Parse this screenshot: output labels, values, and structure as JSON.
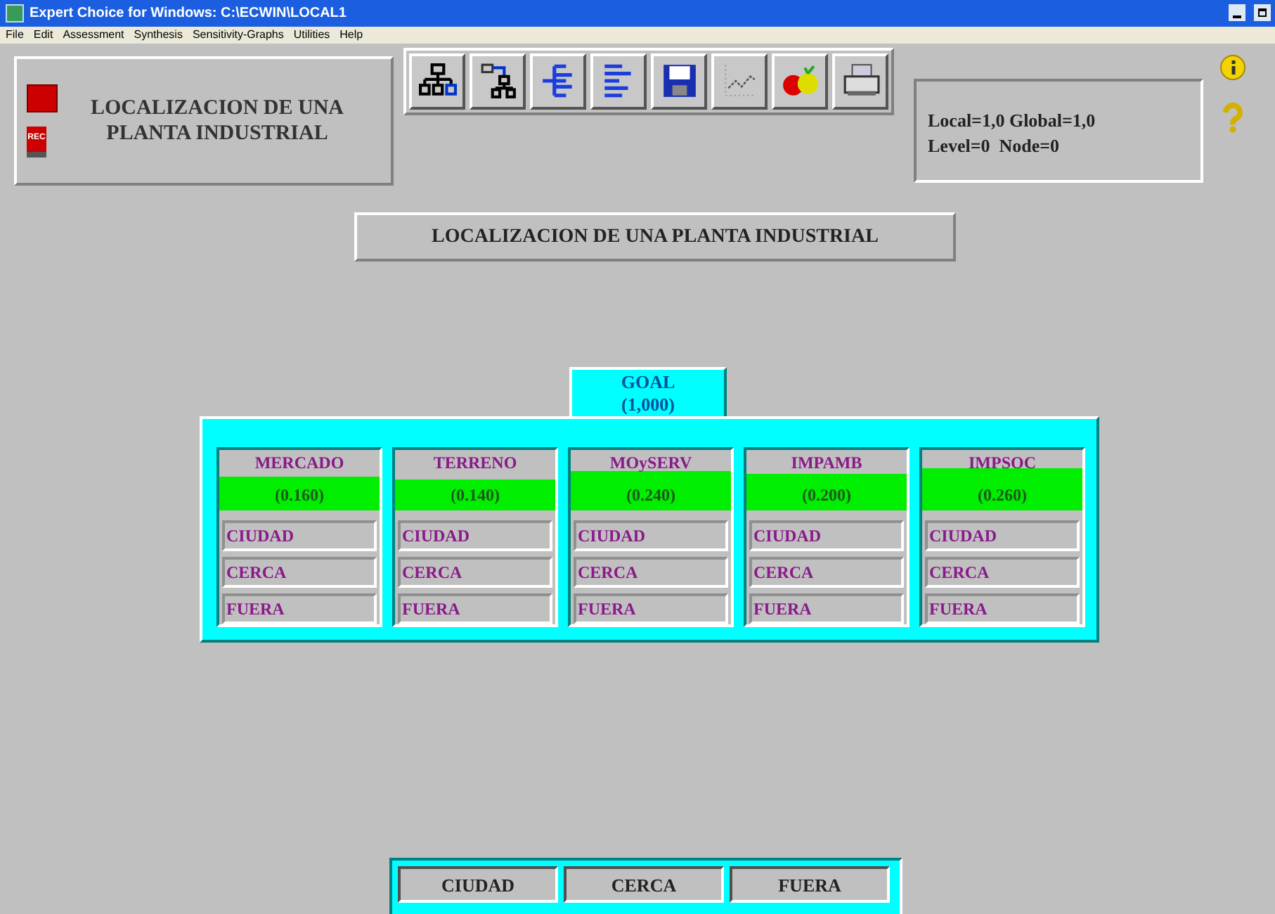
{
  "window": {
    "title": "Expert Choice for Windows: C:\\ECWIN\\LOCAL1"
  },
  "menu": [
    "File",
    "Edit",
    "Assessment",
    "Synthesis",
    "Sensitivity-Graphs",
    "Utilities",
    "Help"
  ],
  "model_panel": {
    "record_label": "REC",
    "title": "LOCALIZACION DE UNA PLANTA INDUSTRIAL"
  },
  "toolbar": [
    {
      "kind": "hierarchy"
    },
    {
      "kind": "transfer"
    },
    {
      "kind": "tree"
    },
    {
      "kind": "list"
    },
    {
      "kind": "save"
    },
    {
      "kind": "graph"
    },
    {
      "kind": "fruit"
    },
    {
      "kind": "print"
    }
  ],
  "info_panel": {
    "line_1": "Local=1,0 Global=1,0",
    "line_2": "Level=0  Node=0"
  },
  "heading": "LOCALIZACION DE UNA PLANTA INDUSTRIAL",
  "goal": {
    "label": "GOAL",
    "priority": "(1,000)"
  },
  "criteria": [
    {
      "name": "MERCADO",
      "priority": "(0.160)",
      "alternatives": [
        "CIUDAD",
        "CERCA",
        "FUERA"
      ]
    },
    {
      "name": "TERRENO",
      "priority": "(0.140)",
      "alternatives": [
        "CIUDAD",
        "CERCA",
        "FUERA"
      ]
    },
    {
      "name": "MOySERV",
      "priority": "(0.240)",
      "alternatives": [
        "CIUDAD",
        "CERCA",
        "FUERA"
      ]
    },
    {
      "name": "IMPAMB",
      "priority": "(0.200)",
      "alternatives": [
        "CIUDAD",
        "CERCA",
        "FUERA"
      ]
    },
    {
      "name": "IMPSOC",
      "priority": "(0.260)",
      "alternatives": [
        "CIUDAD",
        "CERCA",
        "FUERA"
      ]
    }
  ],
  "alternatives_bar": [
    "CIUDAD",
    "CERCA",
    "FUERA"
  ]
}
